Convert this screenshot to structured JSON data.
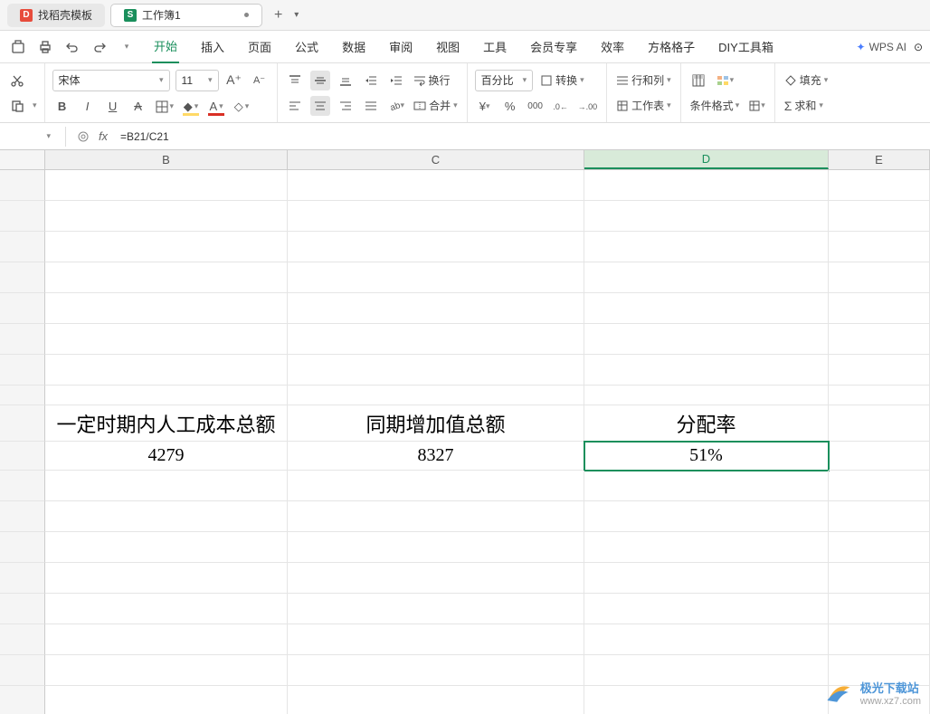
{
  "tabs": {
    "template": "找稻壳模板",
    "workbook": "工作簿1"
  },
  "menu": {
    "items": [
      "开始",
      "插入",
      "页面",
      "公式",
      "数据",
      "审阅",
      "视图",
      "工具",
      "会员专享",
      "效率",
      "方格格子",
      "DIY工具箱"
    ],
    "wps_ai": "WPS AI"
  },
  "toolbar": {
    "font_name": "宋体",
    "font_size": "11",
    "format_select": "百分比",
    "convert": "转换",
    "wrap": "换行",
    "merge": "合并",
    "rowcol": "行和列",
    "sheet": "工作表",
    "condfmt": "条件格式",
    "fill": "填充",
    "sum": "求和"
  },
  "formula_bar": {
    "formula": "=B21/C21"
  },
  "columns": {
    "B": "B",
    "C": "C",
    "D": "D",
    "E": "E"
  },
  "col_widths": {
    "B": 268,
    "C": 328,
    "D": 270,
    "E": 112
  },
  "data": {
    "b_header": "一定时期内人工成本总额",
    "c_header": "同期增加值总额",
    "d_header": "分配率",
    "b_value": "4279",
    "c_value": "8327",
    "d_value": "51%"
  },
  "watermark": {
    "name": "极光下载站",
    "url": "www.xz7.com"
  }
}
